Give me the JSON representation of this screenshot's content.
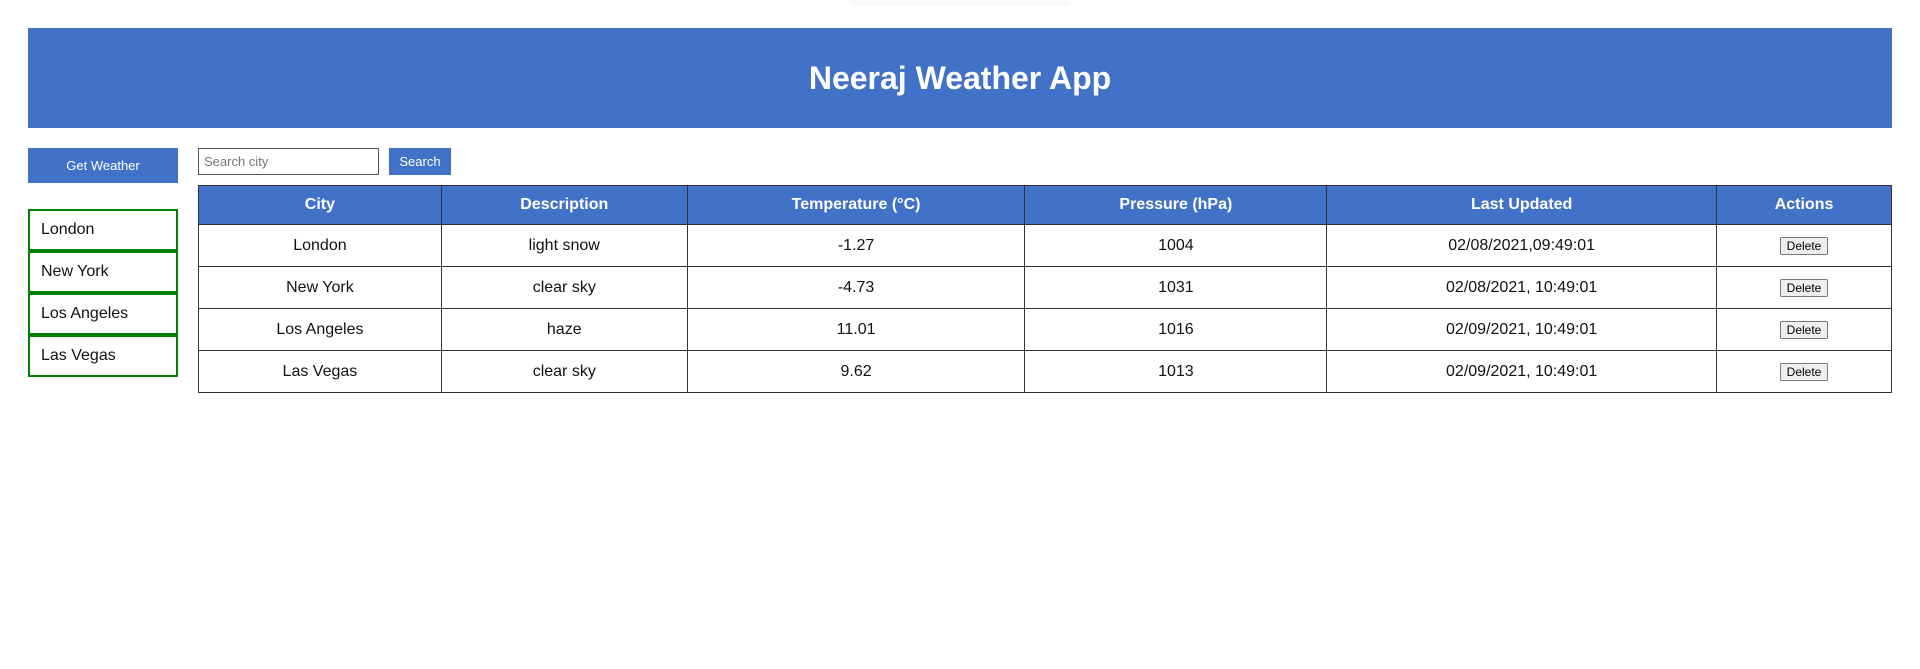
{
  "header": {
    "title": "Neeraj Weather App"
  },
  "sidebar": {
    "get_weather_label": "Get Weather",
    "cities": [
      "London",
      "New York",
      "Los Angeles",
      "Las Vegas"
    ]
  },
  "search": {
    "placeholder": "Search city",
    "button_label": "Search",
    "value": ""
  },
  "table": {
    "headers": [
      "City",
      "Description",
      "Temperature (°C)",
      "Pressure (hPa)",
      "Last Updated",
      "Actions"
    ],
    "rows": [
      {
        "city": "London",
        "description": "light snow",
        "temperature": "-1.27",
        "pressure": "1004",
        "updated": "02/08/2021,09:49:01",
        "action": "Delete"
      },
      {
        "city": "New York",
        "description": "clear sky",
        "temperature": "-4.73",
        "pressure": "1031",
        "updated": "02/08/2021, 10:49:01",
        "action": "Delete"
      },
      {
        "city": "Los Angeles",
        "description": "haze",
        "temperature": "11.01",
        "pressure": "1016",
        "updated": "02/09/2021, 10:49:01",
        "action": "Delete"
      },
      {
        "city": "Las Vegas",
        "description": "clear sky",
        "temperature": "9.62",
        "pressure": "1013",
        "updated": "02/09/2021, 10:49:01",
        "action": "Delete"
      }
    ]
  },
  "colors": {
    "accent": "#4272c7",
    "city_border": "#008000"
  }
}
